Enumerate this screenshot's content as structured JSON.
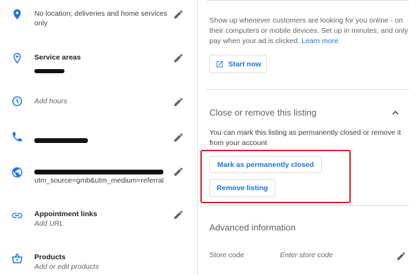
{
  "left_rows": [
    {
      "text": "No location; deliveries and home services only",
      "icon": "location-pin-icon"
    },
    {
      "title": "Service areas",
      "icon": "location-outline-icon"
    },
    {
      "sub": "Add hours",
      "icon": "clock-icon"
    },
    {
      "icon": "phone-icon"
    },
    {
      "text": "utm_source=gmb&utm_medium=referral",
      "icon": "globe-icon"
    },
    {
      "title": "Appointment links",
      "sub": "Add URL",
      "icon": "link-icon"
    },
    {
      "title": "Products",
      "sub": "Add or edit products",
      "icon": "basket-icon"
    }
  ],
  "ads": {
    "description": "Show up whenever customers are looking for you online - on their computers or mobile devices. Set up in minutes, and only pay when your ad is clicked.",
    "learn_more": "Learn more",
    "start_now": "Start now"
  },
  "close_section": {
    "title": "Close or remove this listing",
    "description": "You can mark this listing as permanently closed or remove it from your account",
    "mark_closed": "Mark as permanently closed",
    "remove": "Remove listing"
  },
  "advanced": {
    "title": "Advanced information",
    "store_code_label": "Store code",
    "store_code_placeholder": "Enter store code"
  },
  "colors": {
    "accent": "#1a73e8",
    "highlight": "#d92020"
  }
}
